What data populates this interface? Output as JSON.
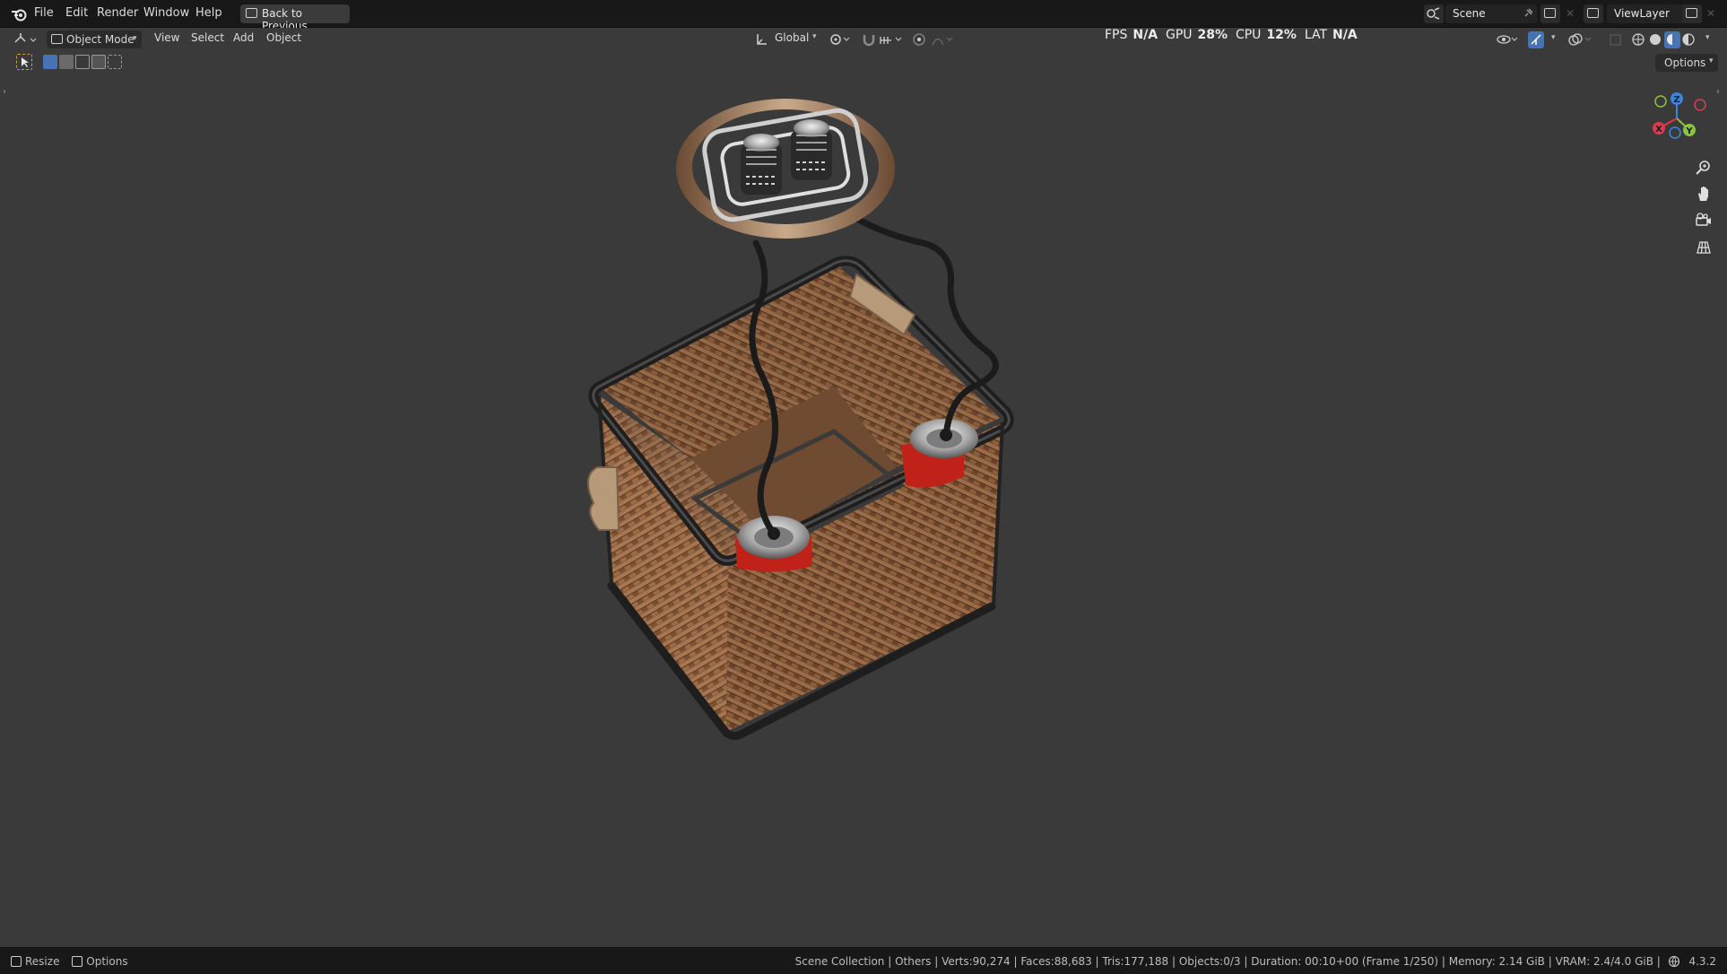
{
  "menubar": {
    "items": [
      "File",
      "Edit",
      "Render",
      "Window",
      "Help"
    ],
    "back_button": "Back to Previous",
    "scene_name": "Scene",
    "view_layer": "ViewLayer"
  },
  "viewport_header": {
    "mode": "Object Mode",
    "menus": [
      "View",
      "Select",
      "Add",
      "Object"
    ],
    "transform_orientation": "Global",
    "options_label": "Options"
  },
  "perf_overlay": {
    "fps_label": "FPS",
    "fps_value": "N/A",
    "gpu_label": "GPU",
    "gpu_value": "28",
    "cpu_label": "CPU",
    "cpu_value": "12",
    "percent": "%",
    "lat_label": "LAT",
    "lat_value": "N/A"
  },
  "gizmo": {
    "x": "X",
    "y": "Y",
    "z": "Z"
  },
  "statusbar": {
    "left_resize": "Resize",
    "left_options": "Options",
    "info": "Scene Collection | Others | Verts:90,274 | Faces:88,683 | Tris:177,188 | Objects:0/3 | Duration: 00:10+00 (Frame 1/250) | Memory: 2.14 GiB | VRAM: 2.4/4.0 GiB |",
    "version": "4.3.2"
  },
  "colors": {
    "viewport_bg": "#3a3a3a",
    "accent_blue": "#4772b3",
    "axis_x": "#e0394f",
    "axis_y": "#8bc43f",
    "axis_z": "#3b84e0"
  }
}
